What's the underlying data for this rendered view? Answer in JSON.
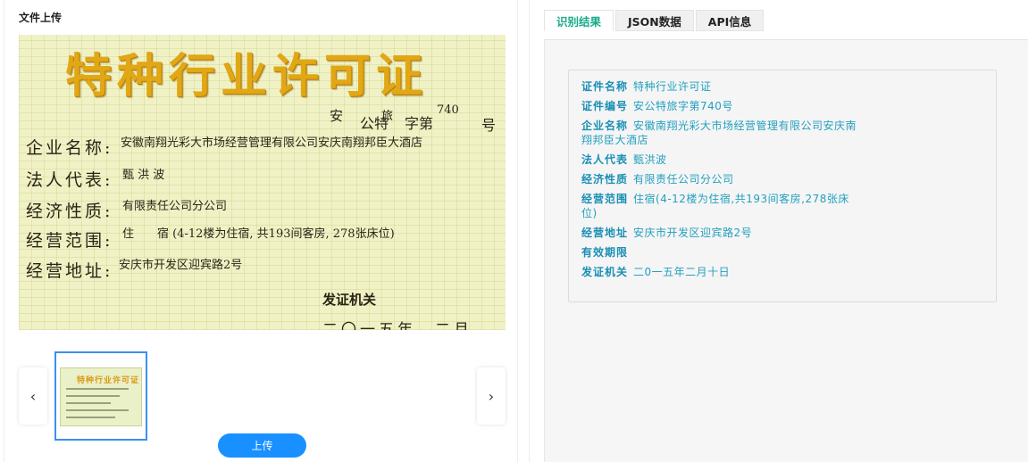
{
  "upload": {
    "title": "文件上传",
    "button_label": "上传",
    "prev_label": "‹",
    "next_label": "›"
  },
  "certificate": {
    "title": "特种行业许可证",
    "number_parts": [
      "安",
      "公特",
      "旅",
      "字第",
      "740",
      "号"
    ],
    "rows": [
      {
        "label": "企业名称:",
        "value": "安徽南翔光彩大市场经营管理有限公司安庆南翔邦臣大酒店"
      },
      {
        "label": "法人代表:",
        "value": "甄 洪 波"
      },
      {
        "label": "经济性质:",
        "value": "有限责任公司分公司"
      },
      {
        "label": "经营范围:",
        "value": "住　　宿 (4-12楼为住宿, 共193间客房, 278张床位)"
      },
      {
        "label": "经营地址:",
        "value": "安庆市开发区迎宾路2号"
      }
    ],
    "issuer": "发证机关",
    "date_partial": "二〇一五年　二月　十　日"
  },
  "thumbnail": {
    "title": "特种行业许可证"
  },
  "tabs": [
    {
      "label": "识别结果",
      "active": true
    },
    {
      "label": "JSON数据",
      "active": false
    },
    {
      "label": "API信息",
      "active": false
    }
  ],
  "results": [
    {
      "key": "证件名称",
      "value": "特种行业许可证"
    },
    {
      "key": "证件编号",
      "value": "安公特旅字第740号"
    },
    {
      "key": "企业名称",
      "value": "安徽南翔光彩大市场经营管理有限公司安庆南翔邦臣大酒店"
    },
    {
      "key": "法人代表",
      "value": "甄洪波"
    },
    {
      "key": "经济性质",
      "value": "有限责任公司分公司"
    },
    {
      "key": "经营范围",
      "value": "住宿(4-12楼为住宿,共193间客房,278张床位)"
    },
    {
      "key": "经营地址",
      "value": "安庆市开发区迎宾路2号"
    },
    {
      "key": "有效期限",
      "value": ""
    },
    {
      "key": "发证机关",
      "value": "二0一五年二月十日"
    }
  ],
  "colors": {
    "accent": "#1aab8a",
    "result_text": "#1a9fbf",
    "upload_button": "#1890ff"
  }
}
